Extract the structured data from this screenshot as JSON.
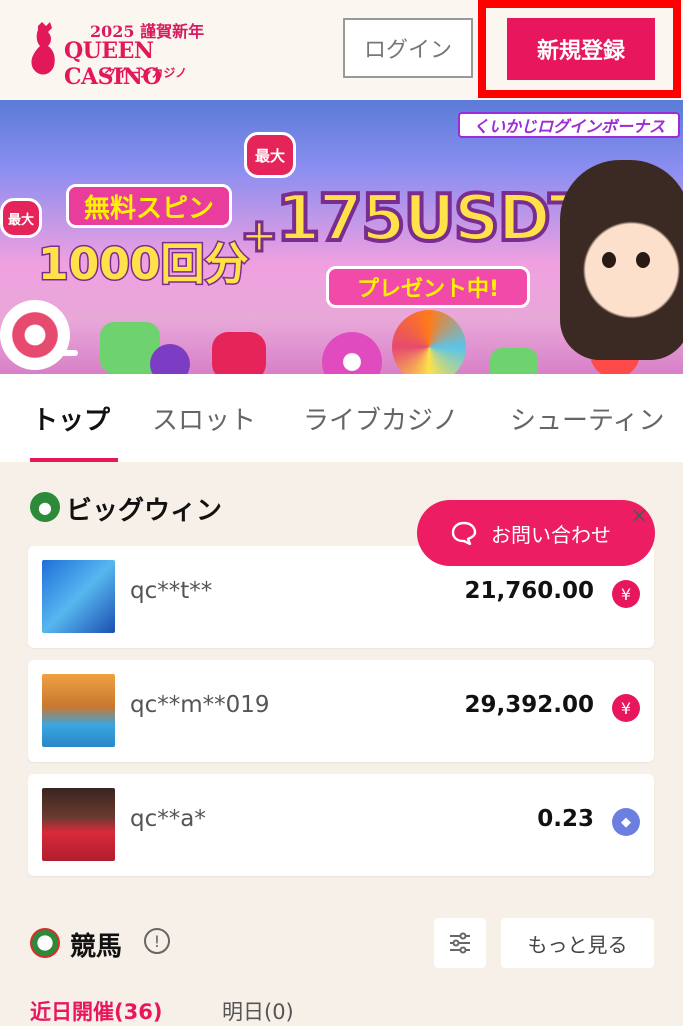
{
  "header": {
    "logo_year": "2025 謹賀新年",
    "logo_name": "QUEEN CASINO",
    "logo_sub": "クイーンカジノ",
    "login_label": "ログイン",
    "signup_label": "新規登録"
  },
  "banner": {
    "tag": "くいかじログインボーナス",
    "max_label_1": "最大",
    "max_label_2": "最大",
    "spin_label": "無料スピン",
    "spin_count": "1000回分",
    "plus": "+",
    "usdt_amount": "175USDT",
    "present": "プレゼント中!"
  },
  "tabs": [
    "トップ",
    "スロット",
    "ライブカジノ",
    "シューティン"
  ],
  "big_win": {
    "title": "ビッグウィン",
    "rows": [
      {
        "user": "qc**t**",
        "amount": "21,760.00",
        "currency_icon": "yen-icon",
        "currency_symbol": "¥",
        "color": "#e8175d"
      },
      {
        "user": "qc**m**019",
        "amount": "29,392.00",
        "currency_icon": "yen-icon",
        "currency_symbol": "¥",
        "color": "#e8175d"
      },
      {
        "user": "qc**a*",
        "amount": "0.23",
        "currency_icon": "ethereum-icon",
        "currency_symbol": "◆",
        "color": "#6b7fe0"
      }
    ]
  },
  "contact": {
    "label": "お問い合わせ",
    "close": "×"
  },
  "racing": {
    "title": "競馬",
    "info": "!",
    "more_label": "もっと見る",
    "sub_tabs": [
      {
        "label": "近日開催(36)"
      },
      {
        "label": "明日(0)"
      }
    ]
  },
  "colors": {
    "accent": "#e8175d",
    "highlight_outline": "#ff0000"
  }
}
